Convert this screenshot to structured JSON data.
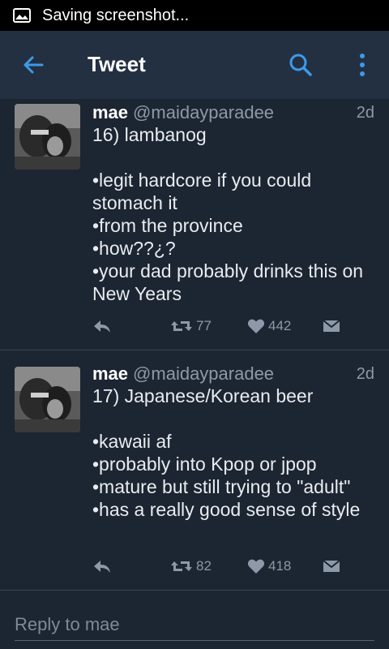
{
  "status_bar": {
    "text": "Saving screenshot..."
  },
  "app_bar": {
    "title": "Tweet"
  },
  "tweets": [
    {
      "name": "mae",
      "handle": "@maidayparadee",
      "time": "2d",
      "lines": [
        "16) lambanog",
        "",
        "•legit hardcore if you could stomach it",
        "•from the province",
        "•how??¿?",
        "•your dad probably drinks this on New Years"
      ],
      "retweets": "77",
      "likes": "442"
    },
    {
      "name": "mae",
      "handle": "@maidayparadee",
      "time": "2d",
      "lines": [
        "17) Japanese/Korean beer",
        "",
        "•kawaii af",
        "•probably into Kpop or jpop",
        "•mature but still trying to \"adult\"",
        "•has a really good sense of style"
      ],
      "retweets": "82",
      "likes": "418"
    }
  ],
  "reply": {
    "placeholder": "Reply to mae"
  },
  "colors": {
    "background": "#1c2532",
    "app_bar": "#233042",
    "accent": "#3d9ae8",
    "muted": "#8d99a8"
  },
  "icons": [
    "gallery-icon",
    "back-arrow-icon",
    "search-icon",
    "more-vert-icon",
    "reply-icon",
    "retweet-icon",
    "heart-icon",
    "direct-message-icon"
  ]
}
